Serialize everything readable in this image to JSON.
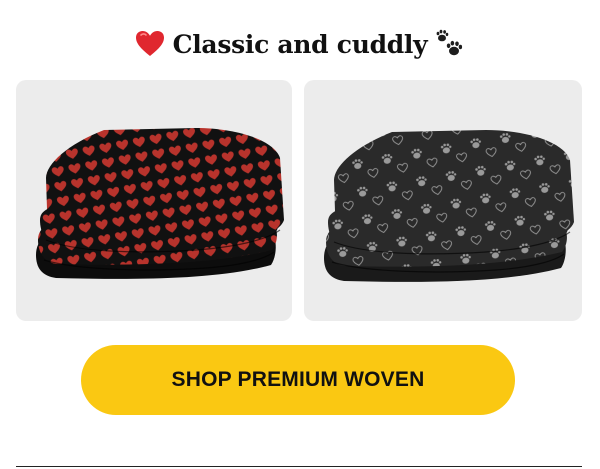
{
  "headline": {
    "text": "Classic and cuddly",
    "leading_icon": "red-heart-icon",
    "trailing_icon": "paw-prints-icon"
  },
  "products": [
    {
      "name": "heart-pattern-blanket",
      "pattern": "red-hearts-on-black"
    },
    {
      "name": "paw-pattern-blanket",
      "pattern": "grey-paws-and-hearts-on-charcoal"
    }
  ],
  "cta": {
    "label": "SHOP PREMIUM WOVEN"
  },
  "colors": {
    "cta_background": "#fac812",
    "card_background": "#ececec",
    "heart_red": "#c0392b"
  }
}
